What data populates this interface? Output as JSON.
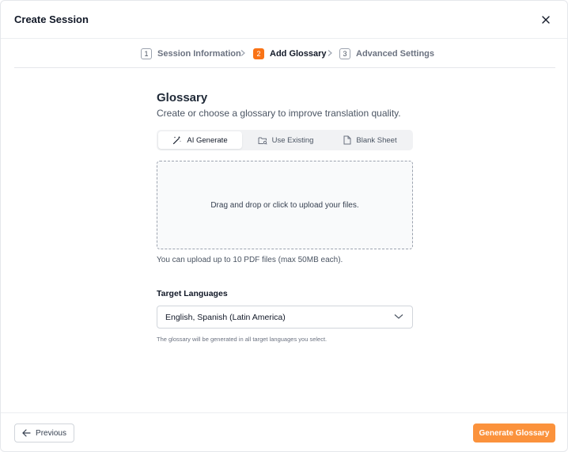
{
  "dialog": {
    "title": "Create Session"
  },
  "stepper": {
    "steps": [
      {
        "number": "1",
        "label": "Session Information",
        "active": false
      },
      {
        "number": "2",
        "label": "Add Glossary",
        "active": true
      },
      {
        "number": "3",
        "label": "Advanced Settings",
        "active": false
      }
    ]
  },
  "glossary": {
    "title": "Glossary",
    "subtitle": "Create or choose a glossary to improve translation quality.",
    "tabs": [
      {
        "label": "AI Generate",
        "icon": "magic-wand-icon",
        "active": true
      },
      {
        "label": "Use Existing",
        "icon": "folder-search-icon",
        "active": false
      },
      {
        "label": "Blank Sheet",
        "icon": "file-icon",
        "active": false
      }
    ],
    "dropzone_text": "Drag and drop or click to upload your files.",
    "upload_hint": "You can upload up to 10 PDF files (max 50MB each).",
    "target_languages": {
      "label": "Target Languages",
      "value": "English, Spanish (Latin America)",
      "help": "The glossary will be generated in all target languages you select."
    }
  },
  "footer": {
    "previous_label": "Previous",
    "primary_label": "Generate Glossary"
  },
  "colors": {
    "accent": "#f97316",
    "primary_button": "#fb923c"
  }
}
